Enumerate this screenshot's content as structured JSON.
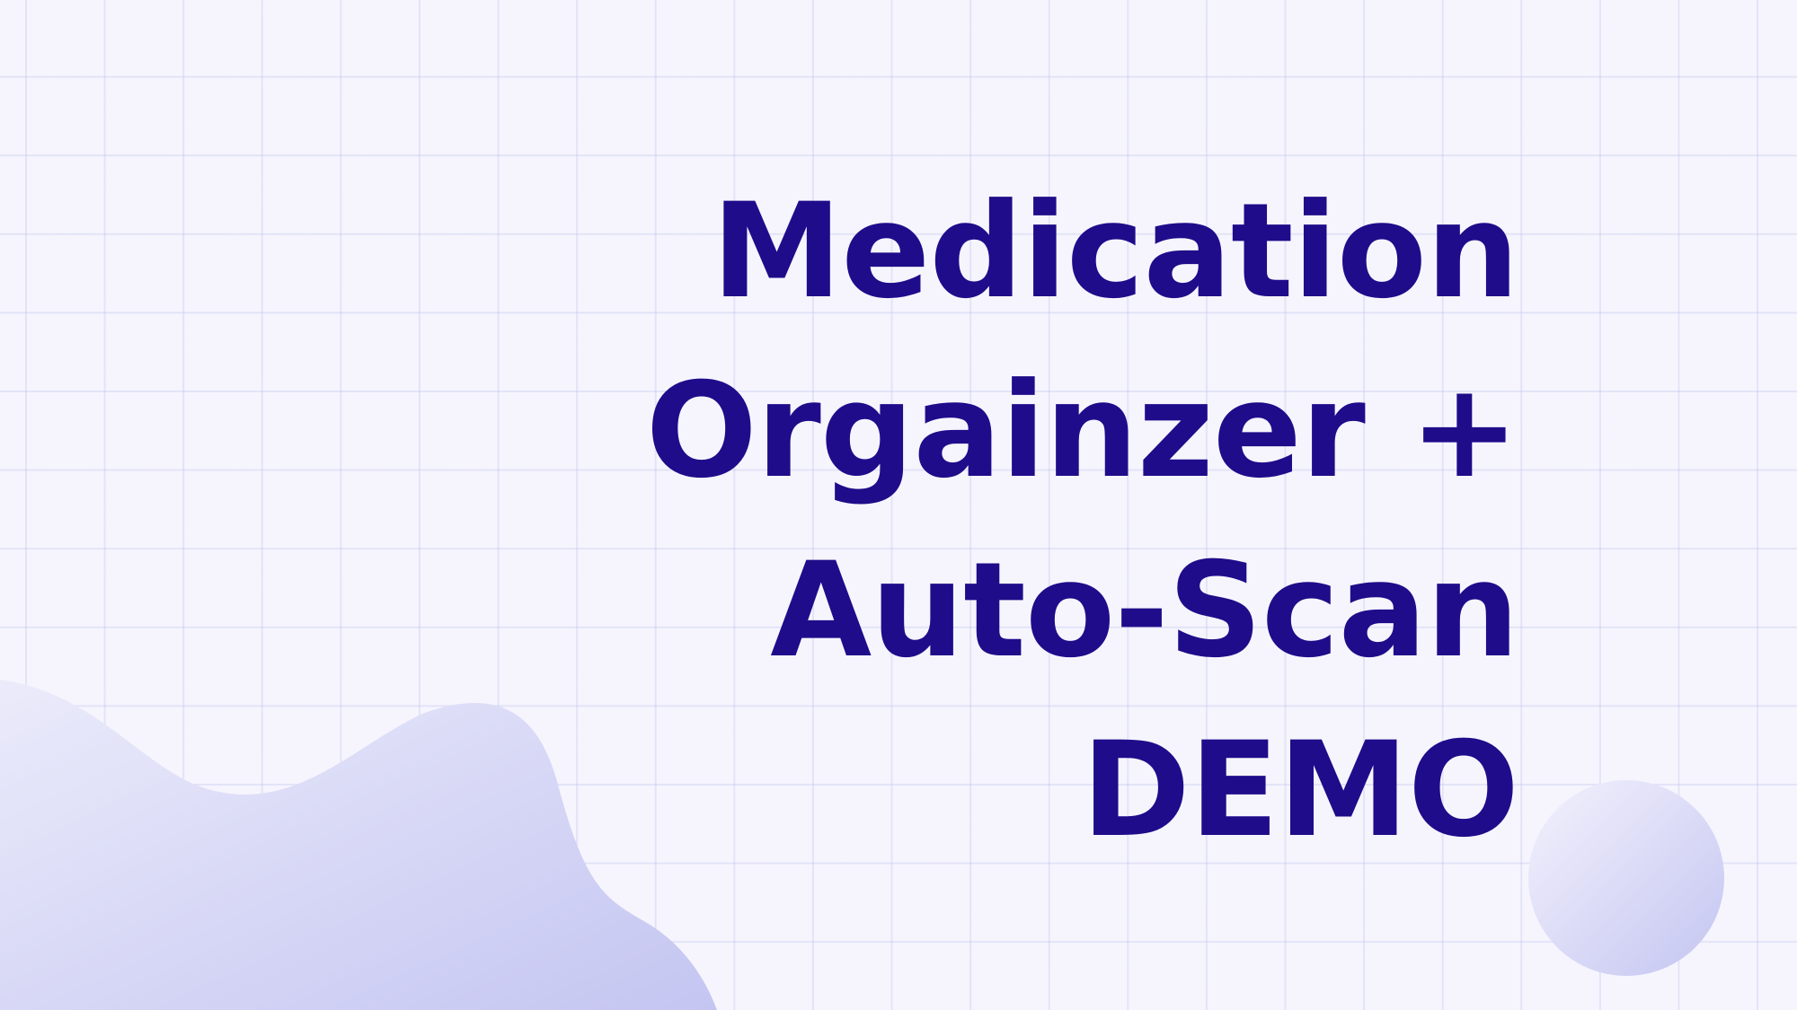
{
  "slide": {
    "title_lines": [
      "Medication",
      "Orgainzer +",
      "Auto-Scan",
      "DEMO"
    ]
  },
  "colors": {
    "background": "#f6f5fe",
    "grid": "#dcdff5",
    "title": "#1f0c8a",
    "blob_light": "#ebebfb",
    "blob_dark": "#c4c5f1"
  },
  "decorations": {
    "wave_shape": "wave-blob",
    "circle_shape": "circle-blob"
  }
}
